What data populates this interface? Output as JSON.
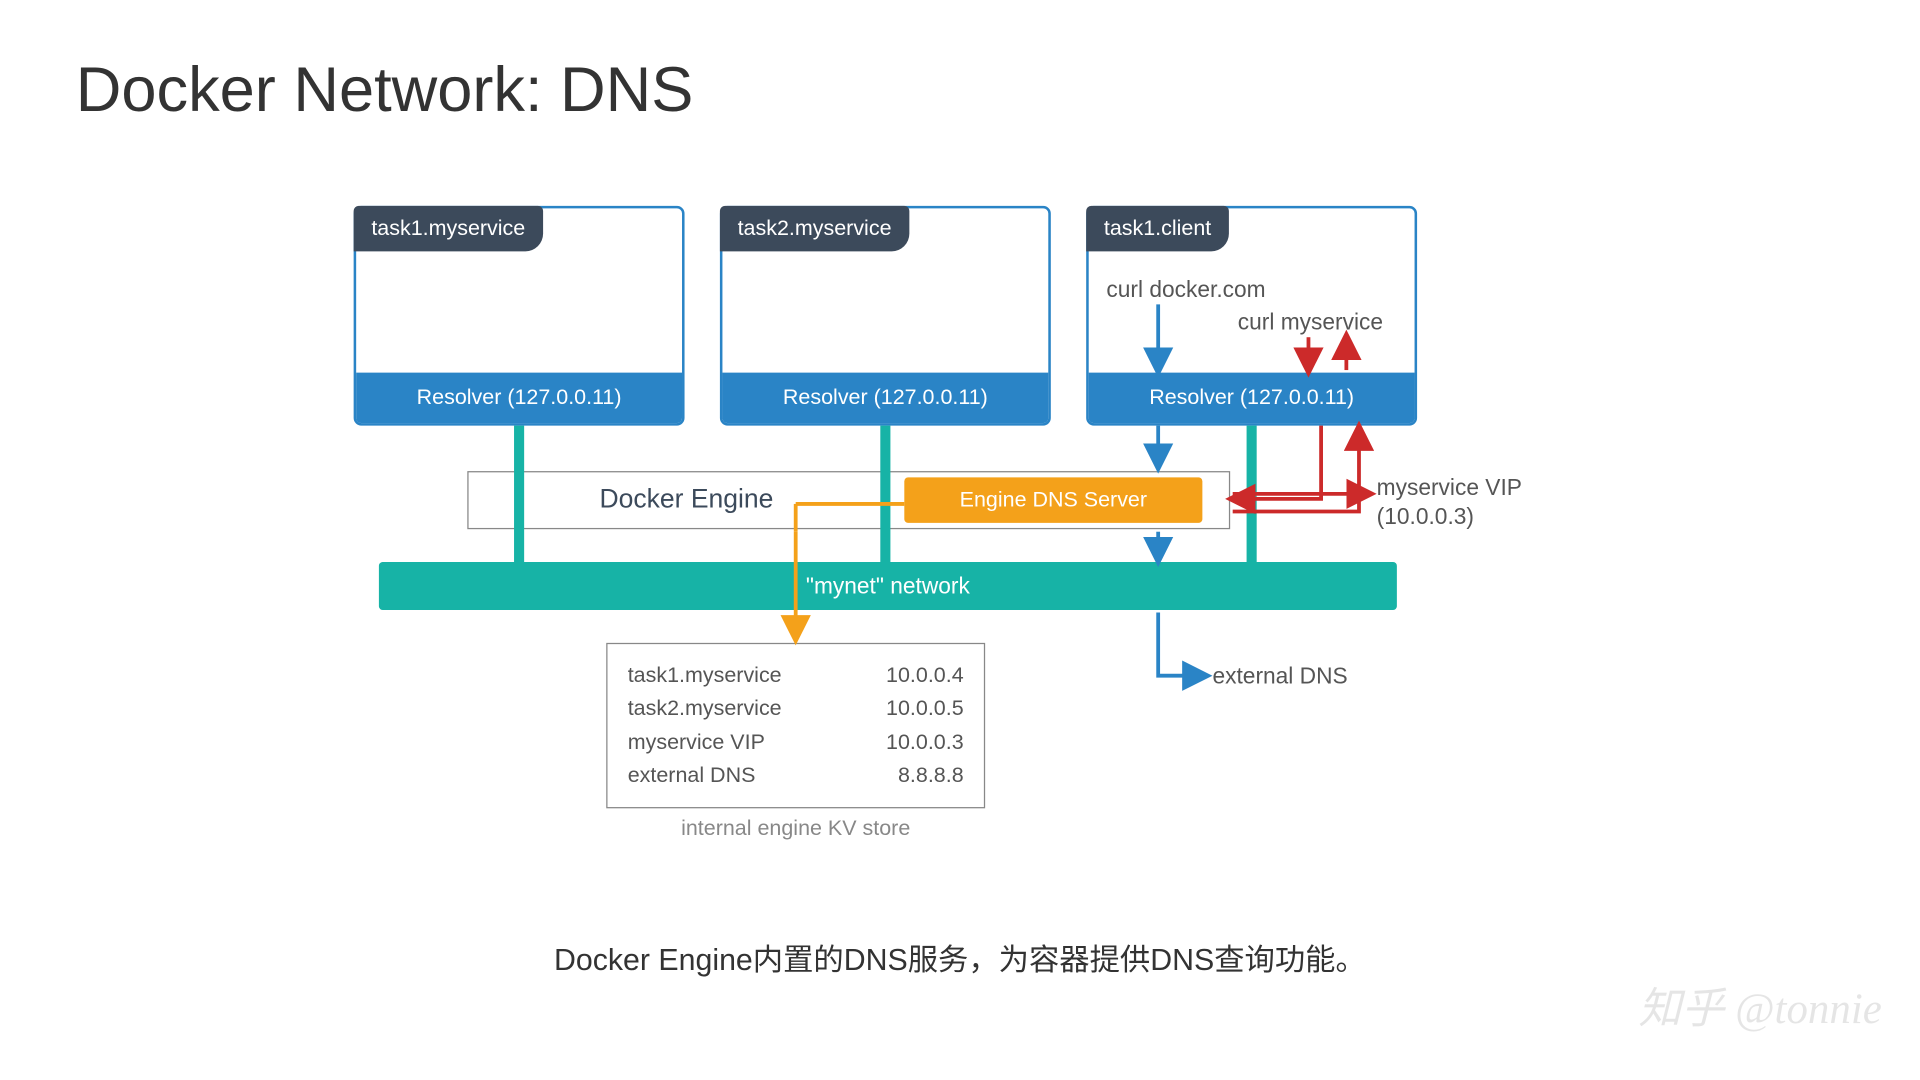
{
  "title": "Docker Network: DNS",
  "containers": [
    {
      "name": "task1.myservice",
      "resolver": "Resolver (127.0.0.11)"
    },
    {
      "name": "task2.myservice",
      "resolver": "Resolver (127.0.0.11)"
    },
    {
      "name": "task1.client",
      "resolver": "Resolver (127.0.0.11)"
    }
  ],
  "client_calls": {
    "left": "curl docker.com",
    "right": "curl myservice"
  },
  "engine": {
    "label": "Docker Engine",
    "dns": "Engine DNS Server"
  },
  "network_bar": "\"mynet\" network",
  "vip_label": {
    "line1": "myservice VIP",
    "line2": "(10.0.0.3)"
  },
  "external_dns_label": "external DNS",
  "kv_store": {
    "caption": "internal engine KV store",
    "rows": [
      {
        "k": "task1.myservice",
        "v": "10.0.0.4"
      },
      {
        "k": "task2.myservice",
        "v": "10.0.0.5"
      },
      {
        "k": "myservice VIP",
        "v": "10.0.0.3"
      },
      {
        "k": "external DNS",
        "v": "8.8.8.8"
      }
    ]
  },
  "caption": "Docker Engine内置的DNS服务，为容器提供DNS查询功能。",
  "watermark": "知乎 @tonnie",
  "colors": {
    "tab": "#3c4a5b",
    "resolver": "#2a84c6",
    "dns_server": "#f4a11a",
    "network": "#17b3a6",
    "ext_arrow": "#2a84c6",
    "vip_arrow": "#cc2a2a"
  }
}
